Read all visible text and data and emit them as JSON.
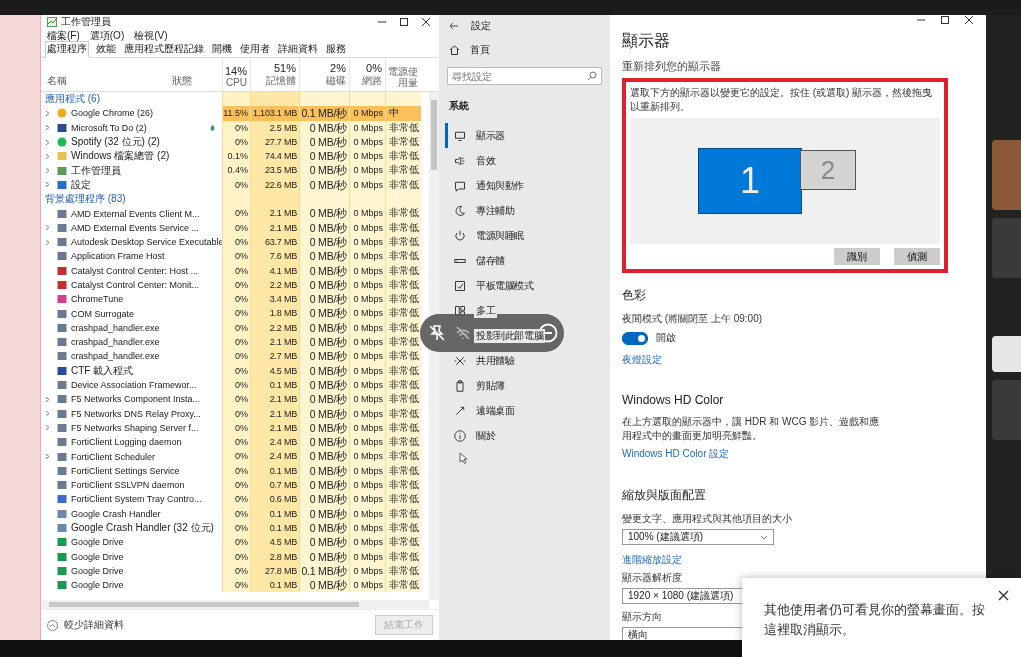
{
  "task_manager": {
    "title": "工作管理員",
    "menu": [
      "檔案(F)",
      "選項(O)",
      "檢視(V)"
    ],
    "tabs": [
      {
        "label": "處理程序",
        "selected": true
      },
      {
        "label": "效能",
        "selected": false
      },
      {
        "label": "應用程式歷程記錄",
        "selected": false
      },
      {
        "label": "開機",
        "selected": false
      },
      {
        "label": "使用者",
        "selected": false
      },
      {
        "label": "詳細資料",
        "selected": false
      },
      {
        "label": "服務",
        "selected": false
      }
    ],
    "columns": [
      {
        "label": "名稱"
      },
      {
        "label": "狀態"
      },
      {
        "percent": "14%",
        "label": "CPU"
      },
      {
        "percent": "51%",
        "label": "記憶體"
      },
      {
        "percent": "2%",
        "label": "磁碟"
      },
      {
        "percent": "0%",
        "label": "網路"
      },
      {
        "label": "電源使用量"
      }
    ],
    "sections": [
      {
        "title": "應用程式 (6)",
        "rows": [
          {
            "name": "Google Chrome (26)",
            "kind": "chrome",
            "expandable": true,
            "highlight": true,
            "cpu": "11.5%",
            "memory": "1,103.1 MB",
            "disk": "0.1 MB/秒",
            "network": "0 Mbps",
            "power": "中"
          },
          {
            "name": "Microsoft To Do (2)",
            "kind": "todo",
            "expandable": true,
            "highlight": false,
            "status_icon": true,
            "cpu": "0%",
            "memory": "2.5 MB",
            "disk": "0 MB/秒",
            "network": "0 Mbps",
            "power": "非常低"
          },
          {
            "name": "Spotify (32 位元) (2)",
            "kind": "spotify",
            "expandable": true,
            "highlight": false,
            "cpu": "0%",
            "memory": "27.7 MB",
            "disk": "0 MB/秒",
            "network": "0 Mbps",
            "power": "非常低"
          },
          {
            "name": "Windows 檔案總管 (2)",
            "kind": "folder",
            "expandable": true,
            "highlight": false,
            "cpu": "0.1%",
            "memory": "74.4 MB",
            "disk": "0 MB/秒",
            "network": "0 Mbps",
            "power": "非常低"
          },
          {
            "name": "工作管理員",
            "kind": "taskmgr",
            "expandable": true,
            "highlight": false,
            "cpu": "0.4%",
            "memory": "23.5 MB",
            "disk": "0 MB/秒",
            "network": "0 Mbps",
            "power": "非常低"
          },
          {
            "name": "設定",
            "kind": "gear",
            "expandable": true,
            "highlight": false,
            "cpu": "0%",
            "memory": "22.6 MB",
            "disk": "0 MB/秒",
            "network": "0 Mbps",
            "power": "非常低"
          }
        ]
      },
      {
        "title": "背景處理程序 (83)",
        "rows": [
          {
            "name": "AMD External Events Client M...",
            "kind": "window",
            "expandable": false,
            "highlight": false,
            "cpu": "0%",
            "memory": "2.1 MB",
            "disk": "0 MB/秒",
            "network": "0 Mbps",
            "power": "非常低"
          },
          {
            "name": "AMD External Events Service ...",
            "kind": "window",
            "expandable": true,
            "highlight": false,
            "cpu": "0%",
            "memory": "2.1 MB",
            "disk": "0 MB/秒",
            "network": "0 Mbps",
            "power": "非常低"
          },
          {
            "name": "Autodesk Desktop Service Executable",
            "kind": "window",
            "expandable": true,
            "highlight": false,
            "cpu": "0%",
            "memory": "63.7 MB",
            "disk": "0 MB/秒",
            "network": "0 Mbps",
            "power": "非常低"
          },
          {
            "name": "Application Frame Host",
            "kind": "window",
            "expandable": false,
            "highlight": false,
            "cpu": "0%",
            "memory": "7.6 MB",
            "disk": "0 MB/秒",
            "network": "0 Mbps",
            "power": "非常低"
          },
          {
            "name": "Catalyst Control Center: Host ...",
            "kind": "amd",
            "expandable": false,
            "highlight": false,
            "cpu": "0%",
            "memory": "4.1 MB",
            "disk": "0 MB/秒",
            "network": "0 Mbps",
            "power": "非常低"
          },
          {
            "name": "Catalyst Control Center: Monit...",
            "kind": "amd",
            "expandable": false,
            "highlight": false,
            "cpu": "0%",
            "memory": "2.2 MB",
            "disk": "0 MB/秒",
            "network": "0 Mbps",
            "power": "非常低"
          },
          {
            "name": "ChromeTune",
            "kind": "colorful",
            "expandable": false,
            "highlight": false,
            "cpu": "0%",
            "memory": "3.4 MB",
            "disk": "0 MB/秒",
            "network": "0 Mbps",
            "power": "非常低"
          },
          {
            "name": "COM Surrogate",
            "kind": "window",
            "expandable": false,
            "highlight": false,
            "cpu": "0%",
            "memory": "1.8 MB",
            "disk": "0 MB/秒",
            "network": "0 Mbps",
            "power": "非常低"
          },
          {
            "name": "crashpad_handler.exe",
            "kind": "window",
            "expandable": false,
            "highlight": false,
            "cpu": "0%",
            "memory": "2.2 MB",
            "disk": "0 MB/秒",
            "network": "0 Mbps",
            "power": "非常低"
          },
          {
            "name": "crashpad_handler.exe",
            "kind": "window",
            "expandable": false,
            "highlight": false,
            "cpu": "0%",
            "memory": "2.1 MB",
            "disk": "0 MB/秒",
            "network": "0 Mbps",
            "power": "非常低"
          },
          {
            "name": "crashpad_handler.exe",
            "kind": "window",
            "expandable": false,
            "highlight": false,
            "cpu": "0%",
            "memory": "2.7 MB",
            "disk": "0 MB/秒",
            "network": "0 Mbps",
            "power": "非常低"
          },
          {
            "name": "CTF 載入程式",
            "kind": "pen",
            "expandable": false,
            "highlight": false,
            "cpu": "0%",
            "memory": "4.5 MB",
            "disk": "0 MB/秒",
            "network": "0 Mbps",
            "power": "非常低"
          },
          {
            "name": "Device Association Framewor...",
            "kind": "window",
            "expandable": false,
            "highlight": false,
            "cpu": "0%",
            "memory": "0.1 MB",
            "disk": "0 MB/秒",
            "network": "0 Mbps",
            "power": "非常低"
          },
          {
            "name": "F5 Networks Component Insta...",
            "kind": "window",
            "expandable": true,
            "highlight": false,
            "cpu": "0%",
            "memory": "2.1 MB",
            "disk": "0 MB/秒",
            "network": "0 Mbps",
            "power": "非常低"
          },
          {
            "name": "F5 Networks DNS Relay Proxy...",
            "kind": "window",
            "expandable": true,
            "highlight": false,
            "cpu": "0%",
            "memory": "2.1 MB",
            "disk": "0 MB/秒",
            "network": "0 Mbps",
            "power": "非常低"
          },
          {
            "name": "F5 Networks Shaping Server f...",
            "kind": "window",
            "expandable": true,
            "highlight": false,
            "cpu": "0%",
            "memory": "2.1 MB",
            "disk": "0 MB/秒",
            "network": "0 Mbps",
            "power": "非常低"
          },
          {
            "name": "FortiClient Logging daemon",
            "kind": "window",
            "expandable": false,
            "highlight": false,
            "cpu": "0%",
            "memory": "2.4 MB",
            "disk": "0 MB/秒",
            "network": "0 Mbps",
            "power": "非常低"
          },
          {
            "name": "FortiClient Scheduler",
            "kind": "window",
            "expandable": true,
            "highlight": false,
            "cpu": "0%",
            "memory": "2.4 MB",
            "disk": "0 MB/秒",
            "network": "0 Mbps",
            "power": "非常低"
          },
          {
            "name": "FortiClient Settings Service",
            "kind": "window",
            "expandable": false,
            "highlight": false,
            "cpu": "0%",
            "memory": "0.1 MB",
            "disk": "0 MB/秒",
            "network": "0 Mbps",
            "power": "非常低"
          },
          {
            "name": "FortiClient SSLVPN daemon",
            "kind": "window",
            "expandable": false,
            "highlight": false,
            "cpu": "0%",
            "memory": "0.7 MB",
            "disk": "0 MB/秒",
            "network": "0 Mbps",
            "power": "非常低"
          },
          {
            "name": "FortiClient System Tray Contro...",
            "kind": "shield",
            "expandable": false,
            "highlight": false,
            "cpu": "0%",
            "memory": "0.6 MB",
            "disk": "0 MB/秒",
            "network": "0 Mbps",
            "power": "非常低"
          },
          {
            "name": "Google Crash Handler",
            "kind": "doc",
            "expandable": false,
            "highlight": false,
            "cpu": "0%",
            "memory": "0.1 MB",
            "disk": "0 MB/秒",
            "network": "0 Mbps",
            "power": "非常低"
          },
          {
            "name": "Google Crash Handler (32 位元)",
            "kind": "doc",
            "expandable": false,
            "highlight": false,
            "cpu": "0%",
            "memory": "0.1 MB",
            "disk": "0 MB/秒",
            "network": "0 Mbps",
            "power": "非常低"
          },
          {
            "name": "Google Drive",
            "kind": "drive",
            "expandable": false,
            "highlight": false,
            "cpu": "0%",
            "memory": "4.5 MB",
            "disk": "0 MB/秒",
            "network": "0 Mbps",
            "power": "非常低"
          },
          {
            "name": "Google Drive",
            "kind": "drive",
            "expandable": false,
            "highlight": false,
            "cpu": "0%",
            "memory": "2.8 MB",
            "disk": "0 MB/秒",
            "network": "0 Mbps",
            "power": "非常低"
          },
          {
            "name": "Google Drive",
            "kind": "drive",
            "expandable": false,
            "highlight": false,
            "cpu": "0%",
            "memory": "27.8 MB",
            "disk": "0.1 MB/秒",
            "network": "0 Mbps",
            "power": "非常低"
          },
          {
            "name": "Google Drive",
            "kind": "drive",
            "expandable": false,
            "highlight": false,
            "cpu": "0%",
            "memory": "0.1 MB",
            "disk": "0 MB/秒",
            "network": "0 Mbps",
            "power": "非常低"
          }
        ]
      }
    ],
    "fewer_details": "較少詳細資料",
    "end_task": {
      "label": "結束工作",
      "disabled": true
    }
  },
  "settings": {
    "title": "設定",
    "home": "首頁",
    "search": {
      "placeholder": "尋找設定"
    },
    "category": "系統",
    "nav": [
      {
        "label": "顯示器",
        "kind": "monitor",
        "selected": true
      },
      {
        "label": "音效",
        "kind": "speaker",
        "selected": false
      },
      {
        "label": "通知與動作",
        "kind": "message",
        "selected": false
      },
      {
        "label": "專注輔助",
        "kind": "moon",
        "selected": false
      },
      {
        "label": "電源與睡眠",
        "kind": "power",
        "selected": false
      },
      {
        "label": "儲存體",
        "kind": "storage",
        "selected": false
      },
      {
        "label": "平板電腦模式",
        "kind": "tablet",
        "selected": false
      },
      {
        "label": "多工",
        "kind": "multitask",
        "selected": false
      },
      {
        "label": "投影到此部電腦",
        "selected": false
      },
      {
        "label": "共用體驗",
        "kind": "share",
        "selected": false
      },
      {
        "label": "剪貼簿",
        "kind": "clipboard",
        "selected": false
      },
      {
        "label": "遠端桌面",
        "kind": "remote",
        "selected": false
      },
      {
        "label": "關於",
        "kind": "info",
        "selected": false
      }
    ],
    "page": {
      "title": "顯示器",
      "arrange_heading": "重新排列您的顯示器",
      "arrange_text": "選取下方的顯示器以變更它的設定。按住 (或選取) 顯示器，然後拖曳以重新排列。",
      "monitors": [
        {
          "label": "1",
          "selected": true
        },
        {
          "label": "2",
          "selected": false
        }
      ],
      "buttons": [
        "識別",
        "偵測"
      ],
      "color_heading": "色彩",
      "night_light_label": "夜間模式 (將關閉至 上午 09:00)",
      "night_light": {
        "on": true,
        "label": "開啟"
      },
      "night_light_link": "夜燈設定",
      "hd_heading": "Windows HD Color",
      "hd_text": "在上方選取的顯示器中，讓 HDR 和 WCG 影片、遊戲和應用程式中的畫面更加明亮鮮豔。",
      "hd_link": "Windows HD Color 設定",
      "scale_heading": "縮放與版面配置",
      "scale_label": "變更文字、應用程式與其他項目的大小",
      "scale_value": "100% (建議選項)",
      "scale_link": "進階縮放設定",
      "resolution_label": "顯示器解析度",
      "resolution_value": "1920 × 1080 (建議選項)",
      "orientation_label": "顯示方向",
      "orientation_value": "橫向"
    }
  },
  "toast": {
    "text": "其他使用者仍可看見你的螢幕畫面。按這裡取消顯示。"
  }
}
